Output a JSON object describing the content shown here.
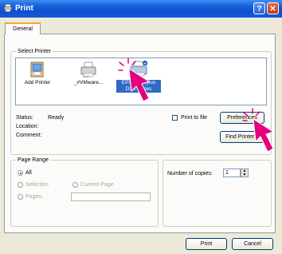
{
  "window": {
    "title": "Print"
  },
  "tabs": [
    {
      "label": "General"
    }
  ],
  "select_printer": {
    "group_label": "Select Printer",
    "printers": [
      {
        "label": "Add Printer"
      },
      {
        "label": "_#VMware..."
      },
      {
        "label_line1": "EPSON Stylus",
        "label_line2": "DX8 Series",
        "selected": true
      }
    ],
    "status_label": "Status:",
    "status_value": "Ready",
    "location_label": "Location:",
    "comment_label": "Comment:",
    "print_to_file_label": "Print to file",
    "preferences_button": "Preferences",
    "find_printer_button": "Find Printer..."
  },
  "page_range": {
    "group_label": "Page Range",
    "all_label": "All",
    "selection_label": "Selection",
    "current_page_label": "Current Page",
    "pages_label": "Pages:",
    "pages_value": ""
  },
  "copies": {
    "label": "Number of copies:",
    "value": "1"
  },
  "footer": {
    "print_button": "Print",
    "cancel_button": "Cancel"
  },
  "colors": {
    "title_bar": "#0b4fd1",
    "accent_cursor": "#e6007e",
    "selection": "#316ac5"
  }
}
